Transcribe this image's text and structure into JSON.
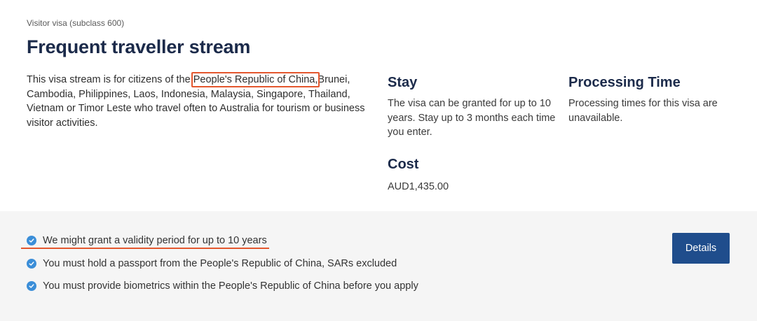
{
  "header": {
    "subclass": "Visitor visa (subclass 600)",
    "title": "Frequent traveller stream"
  },
  "description": {
    "before": "This visa stream is for citizens of the ",
    "highlight": "People's Republic of China,",
    "after": "Brunei, Cambodia, Philippines, Laos, Indonesia, Malaysia, Singapore, Thailand, Vietnam or Timor Leste who travel often to Australia for tourism or business visitor activities."
  },
  "stay": {
    "heading": "Stay",
    "text": "The visa can be granted for up to 10 years. Stay up to 3 months each time you enter."
  },
  "processing": {
    "heading": "Processing Time",
    "text": "Processing times for this visa are unavailable."
  },
  "cost": {
    "heading": "Cost",
    "text": "AUD1,435.00"
  },
  "features": [
    {
      "text": "We might grant a validity period for up to 10 years",
      "icon": "check-circle-icon"
    },
    {
      "text": "You must hold a passport from the People's Republic of China, SARs excluded",
      "icon": "check-circle-icon"
    },
    {
      "text": "You must provide biometrics within the People's Republic of China before you apply",
      "icon": "check-circle-icon"
    }
  ],
  "actions": {
    "details_label": "Details"
  },
  "colors": {
    "title": "#1b2a4a",
    "button": "#1f4d8c",
    "check": "#3b8ed8",
    "annotation": "#e4572e",
    "panel": "#f5f5f5"
  }
}
